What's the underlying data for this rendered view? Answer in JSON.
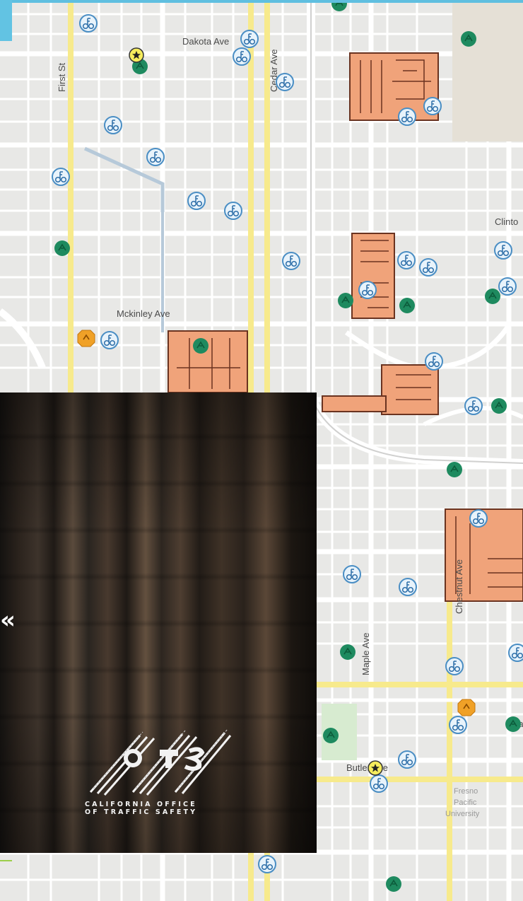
{
  "map": {
    "streets": {
      "dakota": "Dakota Ave",
      "first": "First St",
      "cedar": "Cedar Ave",
      "clinton": "Clinto",
      "mckinley": "Mckinley Ave",
      "chestnut": "Chestnut Ave",
      "maple": "Maple Ave",
      "butler": "Butler Ave",
      "partial_ra": "Ra"
    },
    "poi": {
      "university_line1": "Fresno",
      "university_line2": "Pacific",
      "university_line3": "University"
    },
    "icons": {
      "bike": "bicycle-stand-icon",
      "park": "park-marker-icon",
      "school": "school-marker-icon",
      "star": "star-marker-icon"
    },
    "colors": {
      "major_road": "#f7ea8c",
      "housing_block": "#f0a37a",
      "park": "#1e8a5f",
      "bike": "#4a8ec4",
      "school": "#f0a127"
    }
  },
  "overlay": {
    "chevron": "«",
    "org_line1": "CALIFORNIA OFFICE",
    "org_line2": "OF TRAFFIC SAFETY"
  }
}
